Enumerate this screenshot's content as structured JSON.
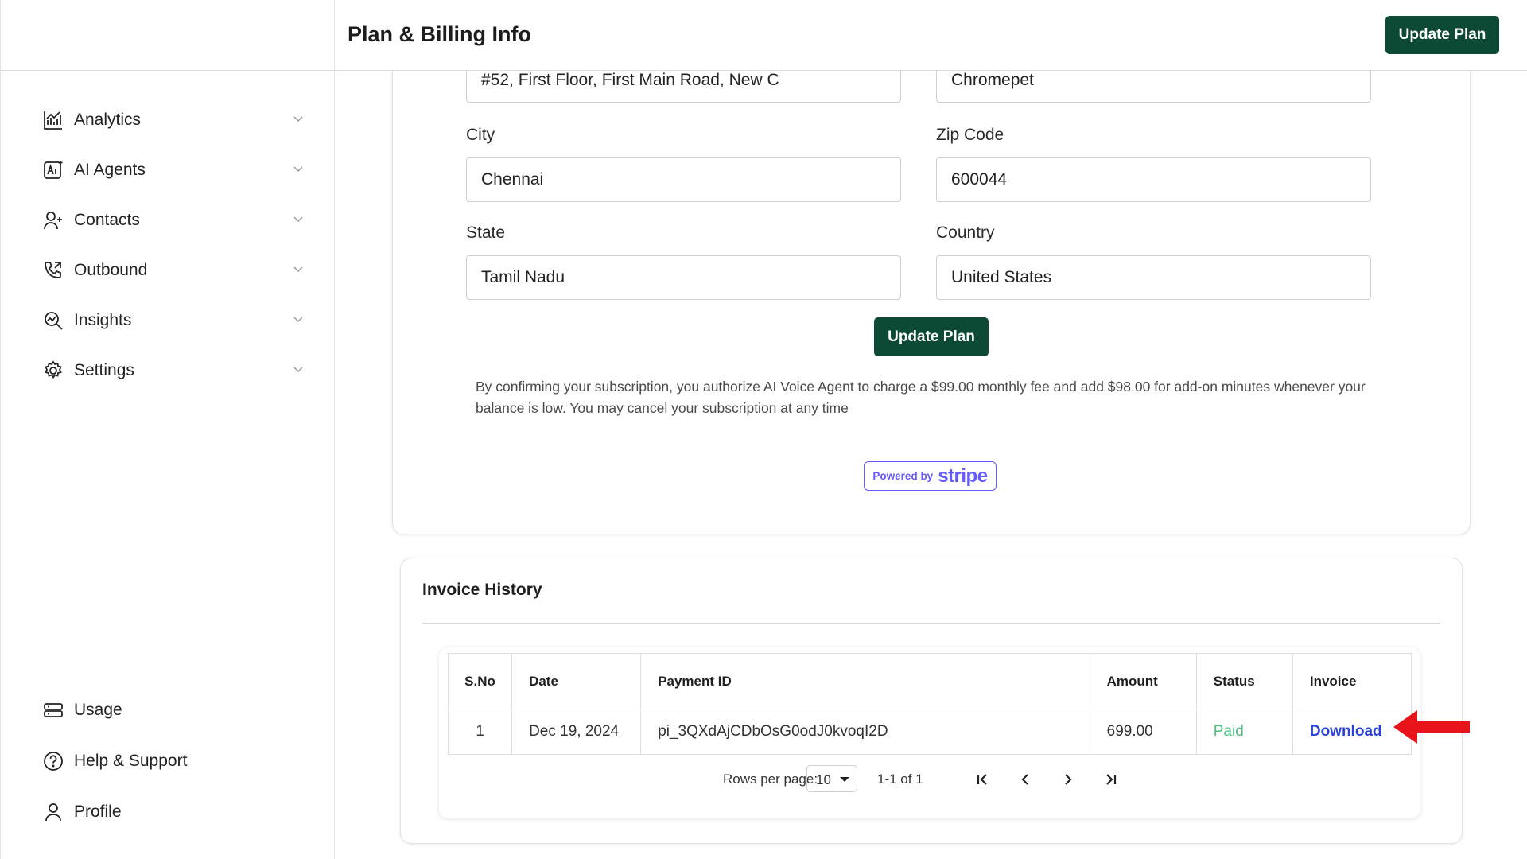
{
  "header": {
    "title": "Plan & Billing Info",
    "update_button": "Update Plan"
  },
  "sidebar": {
    "items": [
      {
        "label": "Analytics",
        "icon": "analytics-icon"
      },
      {
        "label": "AI Agents",
        "icon": "ai-agents-icon"
      },
      {
        "label": "Contacts",
        "icon": "contacts-icon"
      },
      {
        "label": "Outbound",
        "icon": "phone-icon"
      },
      {
        "label": "Insights",
        "icon": "insights-icon"
      },
      {
        "label": "Settings",
        "icon": "gear-icon"
      }
    ],
    "bottom_items": [
      {
        "label": "Usage",
        "icon": "usage-icon"
      },
      {
        "label": "Help & Support",
        "icon": "help-icon"
      },
      {
        "label": "Profile",
        "icon": "profile-icon"
      }
    ]
  },
  "form": {
    "address1": "#52, First Floor, First Main Road, New C",
    "address2": "Chromepet",
    "city_label": "City",
    "city": "Chennai",
    "zip_label": "Zip Code",
    "zip": "600044",
    "state_label": "State",
    "state": "Tamil Nadu",
    "country_label": "Country",
    "country": "United States",
    "update_button": "Update Plan",
    "consent": "By confirming your subscription, you authorize AI Voice Agent to charge a $99.00 monthly fee and add $98.00 for add-on minutes whenever your balance is low. You may cancel your subscription at any time",
    "powered_by": "Powered by",
    "stripe": "stripe"
  },
  "invoices": {
    "title": "Invoice History",
    "columns": [
      "S.No",
      "Date",
      "Payment ID",
      "Amount",
      "Status",
      "Invoice"
    ],
    "rows": [
      {
        "sno": "1",
        "date": "Dec 19, 2024",
        "payment_id": "pi_3QXdAjCDbOsG0odJ0kvoqI2D",
        "amount": "699.00",
        "status": "Paid",
        "invoice": "Download"
      }
    ],
    "rows_per_page_label": "Rows per page:",
    "rows_per_page": "10",
    "range": "1-1 of 1"
  },
  "colors": {
    "primary": "#0d4a36",
    "paid": "#4cbf7f",
    "link": "#2b42d8",
    "stripe": "#635bff",
    "arrow": "#e8141a"
  }
}
